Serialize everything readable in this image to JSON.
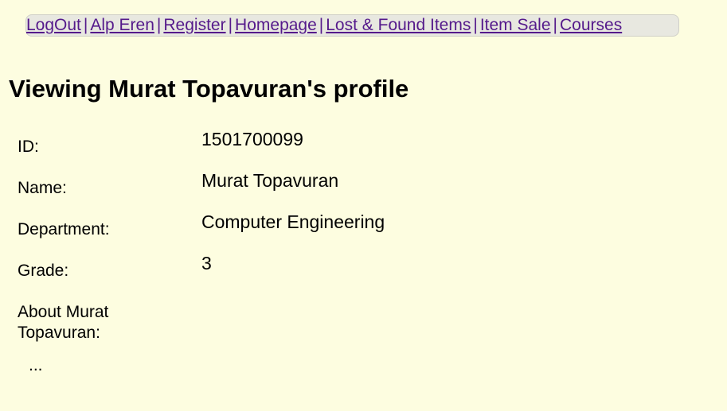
{
  "nav": {
    "links": [
      "LogOut",
      "Alp Eren",
      "Register",
      "Homepage",
      "Lost & Found Items",
      "Item Sale",
      "Courses"
    ],
    "separator": "|"
  },
  "page_title": "Viewing Murat Topavuran's profile",
  "profile": {
    "id_label": "ID:",
    "id_value": "1501700099",
    "name_label": "Name:",
    "name_value": "Murat Topavuran",
    "department_label": "Department:",
    "department_value": "Computer Engineering",
    "grade_label": "Grade:",
    "grade_value": "3",
    "about_label": "About Murat Topavuran:",
    "about_value": "..."
  },
  "colors": {
    "background": "#fdfde0",
    "link": "#551a8b",
    "navbar_bg": "#e8e8e0"
  }
}
